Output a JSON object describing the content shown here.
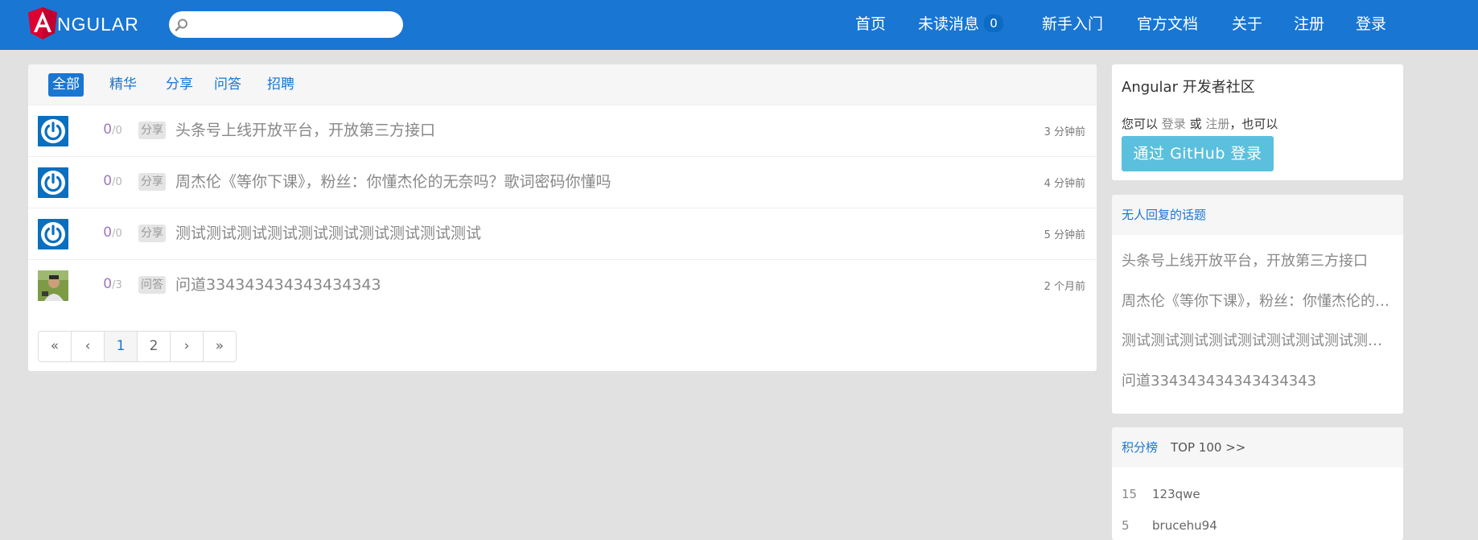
{
  "header": {
    "logo_text": "NGULAR",
    "search_placeholder": "",
    "nav": [
      {
        "label": "首页"
      },
      {
        "label": "未读消息",
        "badge": "0"
      },
      {
        "label": "新手入门"
      },
      {
        "label": "官方文档"
      },
      {
        "label": "关于"
      },
      {
        "label": "注册"
      },
      {
        "label": "登录"
      }
    ]
  },
  "tabs": [
    "全部",
    "精华",
    "分享",
    "问答",
    "招聘"
  ],
  "topics": [
    {
      "reply": "0",
      "visit": "0",
      "tag": "分享",
      "title": "头条号上线开放平台，开放第三方接口",
      "time": "3 分钟前",
      "avatar": "power-icon"
    },
    {
      "reply": "0",
      "visit": "0",
      "tag": "分享",
      "title": "周杰伦《等你下课》，粉丝：你懂杰伦的无奈吗？歌词密码你懂吗",
      "time": "4 分钟前",
      "avatar": "power-icon"
    },
    {
      "reply": "0",
      "visit": "0",
      "tag": "分享",
      "title": "测试测试测试测试测试测试测试测试测试测试",
      "time": "5 分钟前",
      "avatar": "power-icon"
    },
    {
      "reply": "0",
      "visit": "3",
      "tag": "问答",
      "title": "问道334343434343434343",
      "time": "2 个月前",
      "avatar": "user-photo"
    }
  ],
  "pagination": {
    "first": "«",
    "prev": "‹",
    "pages": [
      "1",
      "2"
    ],
    "next": "›",
    "last": "»",
    "current": "1"
  },
  "sidebar": {
    "community_title": "Angular 开发者社区",
    "login_hint_prefix": "您可以",
    "login_link": "登录",
    "or_text": "或",
    "register_link": "注册",
    "login_hint_suffix": "，也可以",
    "github_button": "通过 GitHub 登录",
    "no_reply_header": "无人回复的话题",
    "no_reply_items": [
      "头条号上线开放平台，开放第三方接口",
      "周杰伦《等你下课》，粉丝：你懂杰伦的无奈吗？歌词密码你懂吗",
      "测试测试测试测试测试测试测试测试测试测试",
      "问道334343434343434343"
    ],
    "ranking_header": "积分榜",
    "ranking_more": "TOP 100 >>",
    "ranking": [
      {
        "score": "15",
        "name": "123qwe"
      },
      {
        "score": "5",
        "name": "brucehu94"
      }
    ]
  },
  "colors": {
    "brand": "#1976d2",
    "github_button": "#5bc0de",
    "background": "#e1e1e1"
  }
}
